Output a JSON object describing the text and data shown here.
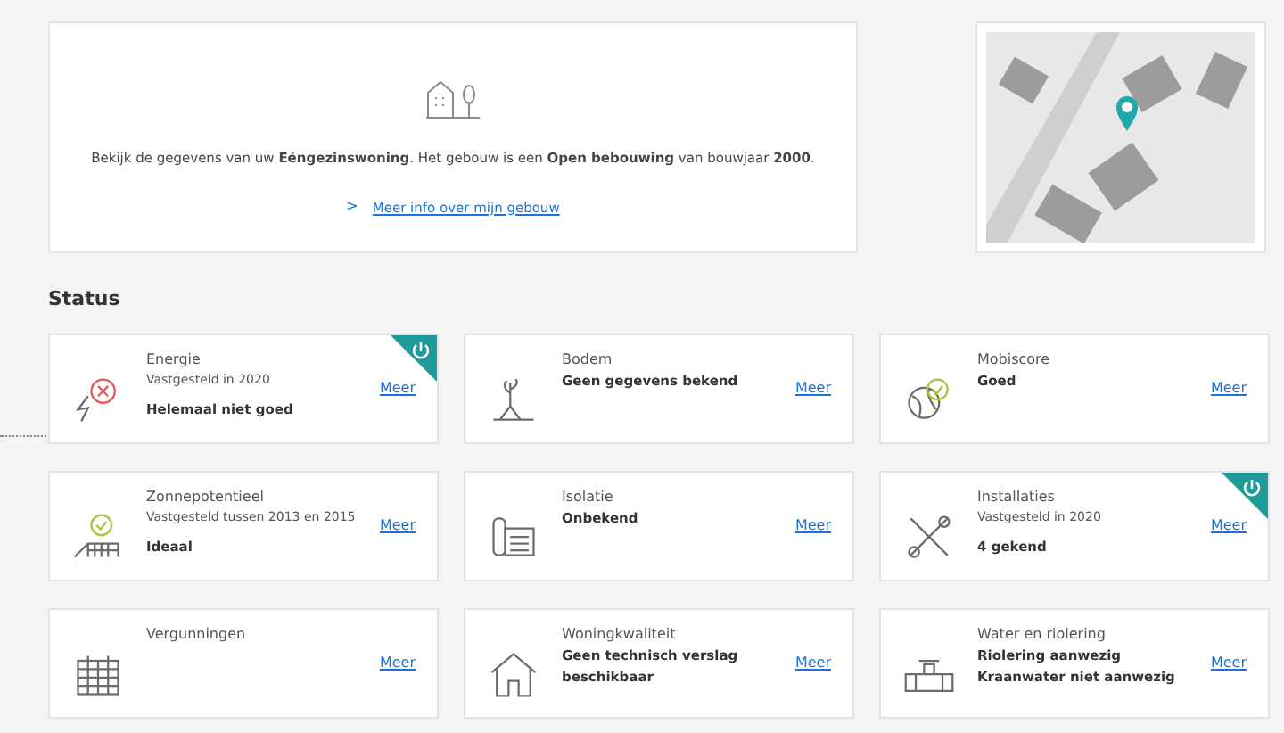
{
  "building": {
    "intro": "Bekijk de gegevens van uw **Eéngezinswoning**. Het gebouw is een **Open bebouwing** van bouwjaar **2000**.",
    "link_arrow": ">",
    "link": "Meer info over mijn gebouw"
  },
  "status": {
    "title": "Status",
    "cards": [
      {
        "kind": "energy",
        "title": "Energie",
        "subtitle": "Vastgesteld in 2020",
        "values": [
          "Helemaal niet goed"
        ],
        "badge": true,
        "link": "Meer"
      },
      {
        "kind": "soil",
        "title": "Bodem",
        "values": [
          "Geen gegevens bekend"
        ],
        "badge": false,
        "link": "Meer"
      },
      {
        "kind": "mobility",
        "title": "Mobiscore",
        "values": [
          "Goed"
        ],
        "badge": false,
        "link": "Meer"
      },
      {
        "kind": "solar",
        "title": "Zonnepotentieel",
        "subtitle": "Vastgesteld tussen 2013 en 2015",
        "values": [
          "Ideaal"
        ],
        "badge": false,
        "link": "Meer"
      },
      {
        "kind": "insulation",
        "title": "Isolatie",
        "values": [
          "Onbekend"
        ],
        "badge": false,
        "link": "Meer"
      },
      {
        "kind": "tools",
        "title": "Installaties",
        "subtitle": "Vastgesteld in 2020",
        "values": [
          "4 gekend"
        ],
        "badge": true,
        "link": "Meer"
      },
      {
        "kind": "permits",
        "title": "Vergunningen",
        "badge": false,
        "link": "Meer"
      },
      {
        "kind": "house",
        "title": "Woningkwaliteit",
        "values": [
          "Geen technisch verslag beschikbaar"
        ],
        "badge": false,
        "link": "Meer"
      },
      {
        "kind": "water",
        "title": "Water en riolering",
        "values": [
          "Riolering aanwezig",
          "Kraanwater niet aanwezig"
        ],
        "badge": false,
        "link": "Meer"
      }
    ]
  }
}
